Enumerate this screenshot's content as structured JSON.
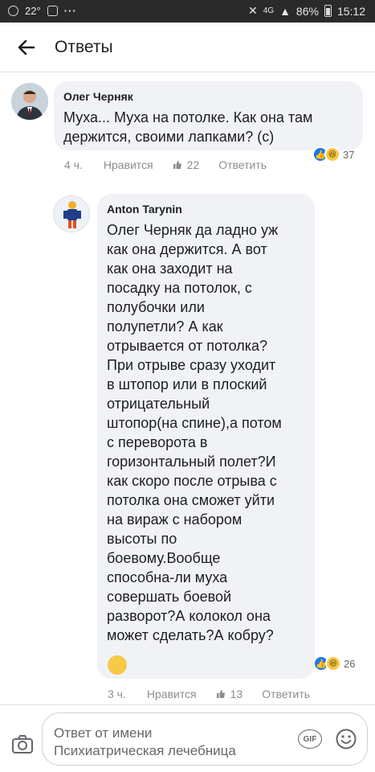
{
  "status_bar": {
    "temperature": "22°",
    "network": "4G",
    "battery": "86%",
    "time": "15:12"
  },
  "header": {
    "title": "Ответы"
  },
  "comment": {
    "author": "Олег Черняк",
    "text": "Муха... Муха на потолке. Как она там держится, своими лапками? (c)",
    "reactions_count": "37",
    "time": "4 ч.",
    "like_label": "Нравится",
    "likes": "22",
    "reply_label": "Ответить"
  },
  "reply": {
    "author": "Anton Tarynin",
    "text": "Олег Черняк да ладно уж\nкак она держится. А вот\nкак она заходит на\nпосадку на потолок, с\nполубочки или\nполупетли? А как\nотрывается от потолка?\nПри отрыве сразу уходит\nв штопор или в плоский\nотрицательный\nштопор(на спине),а потом\nс переворота в\nгоризонтальный полет?И\nкак скоро после отрыва с\nпотолка она сможет уйти\nна вираж с набором\nвысоты по\nбоевому.Вообще\nспособна-ли муха\nсовершать боевой\nразворот?А колокол она\nможет сделать?А кобру?",
    "reactions_count": "26",
    "time": "3 ч.",
    "like_label": "Нравится",
    "likes": "13",
    "reply_label": "Ответить"
  },
  "composer": {
    "placeholder": "Ответ от имени\nПсихиатрическая лечебница",
    "gif_label": "GIF"
  },
  "icons": {
    "accent": "#1877f2",
    "haha": "#f7c948"
  }
}
